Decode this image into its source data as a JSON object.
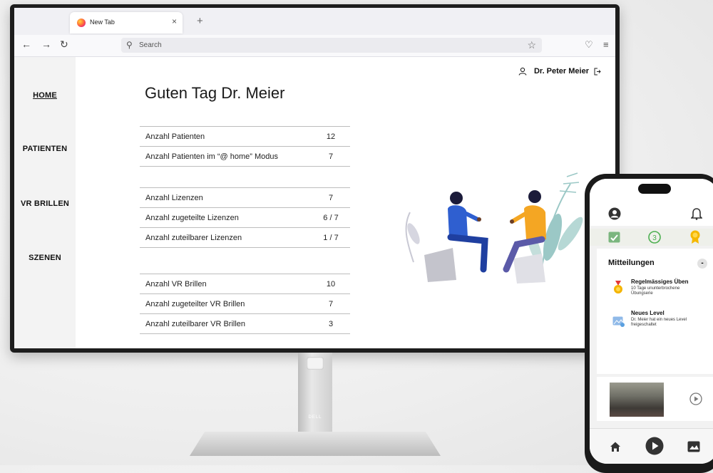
{
  "browser": {
    "tab_title": "New Tab",
    "tab_close": "×",
    "new_tab": "+",
    "search_placeholder": "Search"
  },
  "sidebar": {
    "items": [
      {
        "label": "HOME",
        "active": true
      },
      {
        "label": "PATIENTEN"
      },
      {
        "label": "VR BRILLEN"
      },
      {
        "label": "SZENEN"
      }
    ]
  },
  "user": {
    "name": "Dr. Peter Meier"
  },
  "greeting": "Guten Tag Dr. Meier",
  "stats": {
    "patients": [
      {
        "label": "Anzahl Patienten",
        "value": "12"
      },
      {
        "label": "Anzahl Patienten im “@ home” Modus",
        "value": "7"
      }
    ],
    "licenses": [
      {
        "label": "Anzahl Lizenzen",
        "value": "7"
      },
      {
        "label": "Anzahl zugeteilte Lizenzen",
        "value": "6 / 7"
      },
      {
        "label": "Anzahl zuteilbarer Lizenzen",
        "value": "1 / 7"
      }
    ],
    "vr_glasses": [
      {
        "label": "Anzahl VR Brillen",
        "value": "10"
      },
      {
        "label": "Anzahl zugeteilter VR Brillen",
        "value": "7"
      },
      {
        "label": "Anzahl zuteilbarer VR Brillen",
        "value": "3"
      }
    ]
  },
  "monitor_brand": "DELL",
  "phone": {
    "level_badge": "3",
    "card_title": "Mitteilungen",
    "collapse_label": "-",
    "notifications": [
      {
        "title": "Regelmässiges Üben",
        "text": "10 Tage ununterbrochene Übungserie"
      },
      {
        "title": "Neues Level",
        "text": "Dr. Meier hat ein neues Level freigeschaltet"
      }
    ]
  },
  "colors": {
    "accent_blue": "#2f5fd0",
    "accent_orange": "#f4a623",
    "plant_teal": "#9bc8c6",
    "level_green": "#4caf50"
  }
}
